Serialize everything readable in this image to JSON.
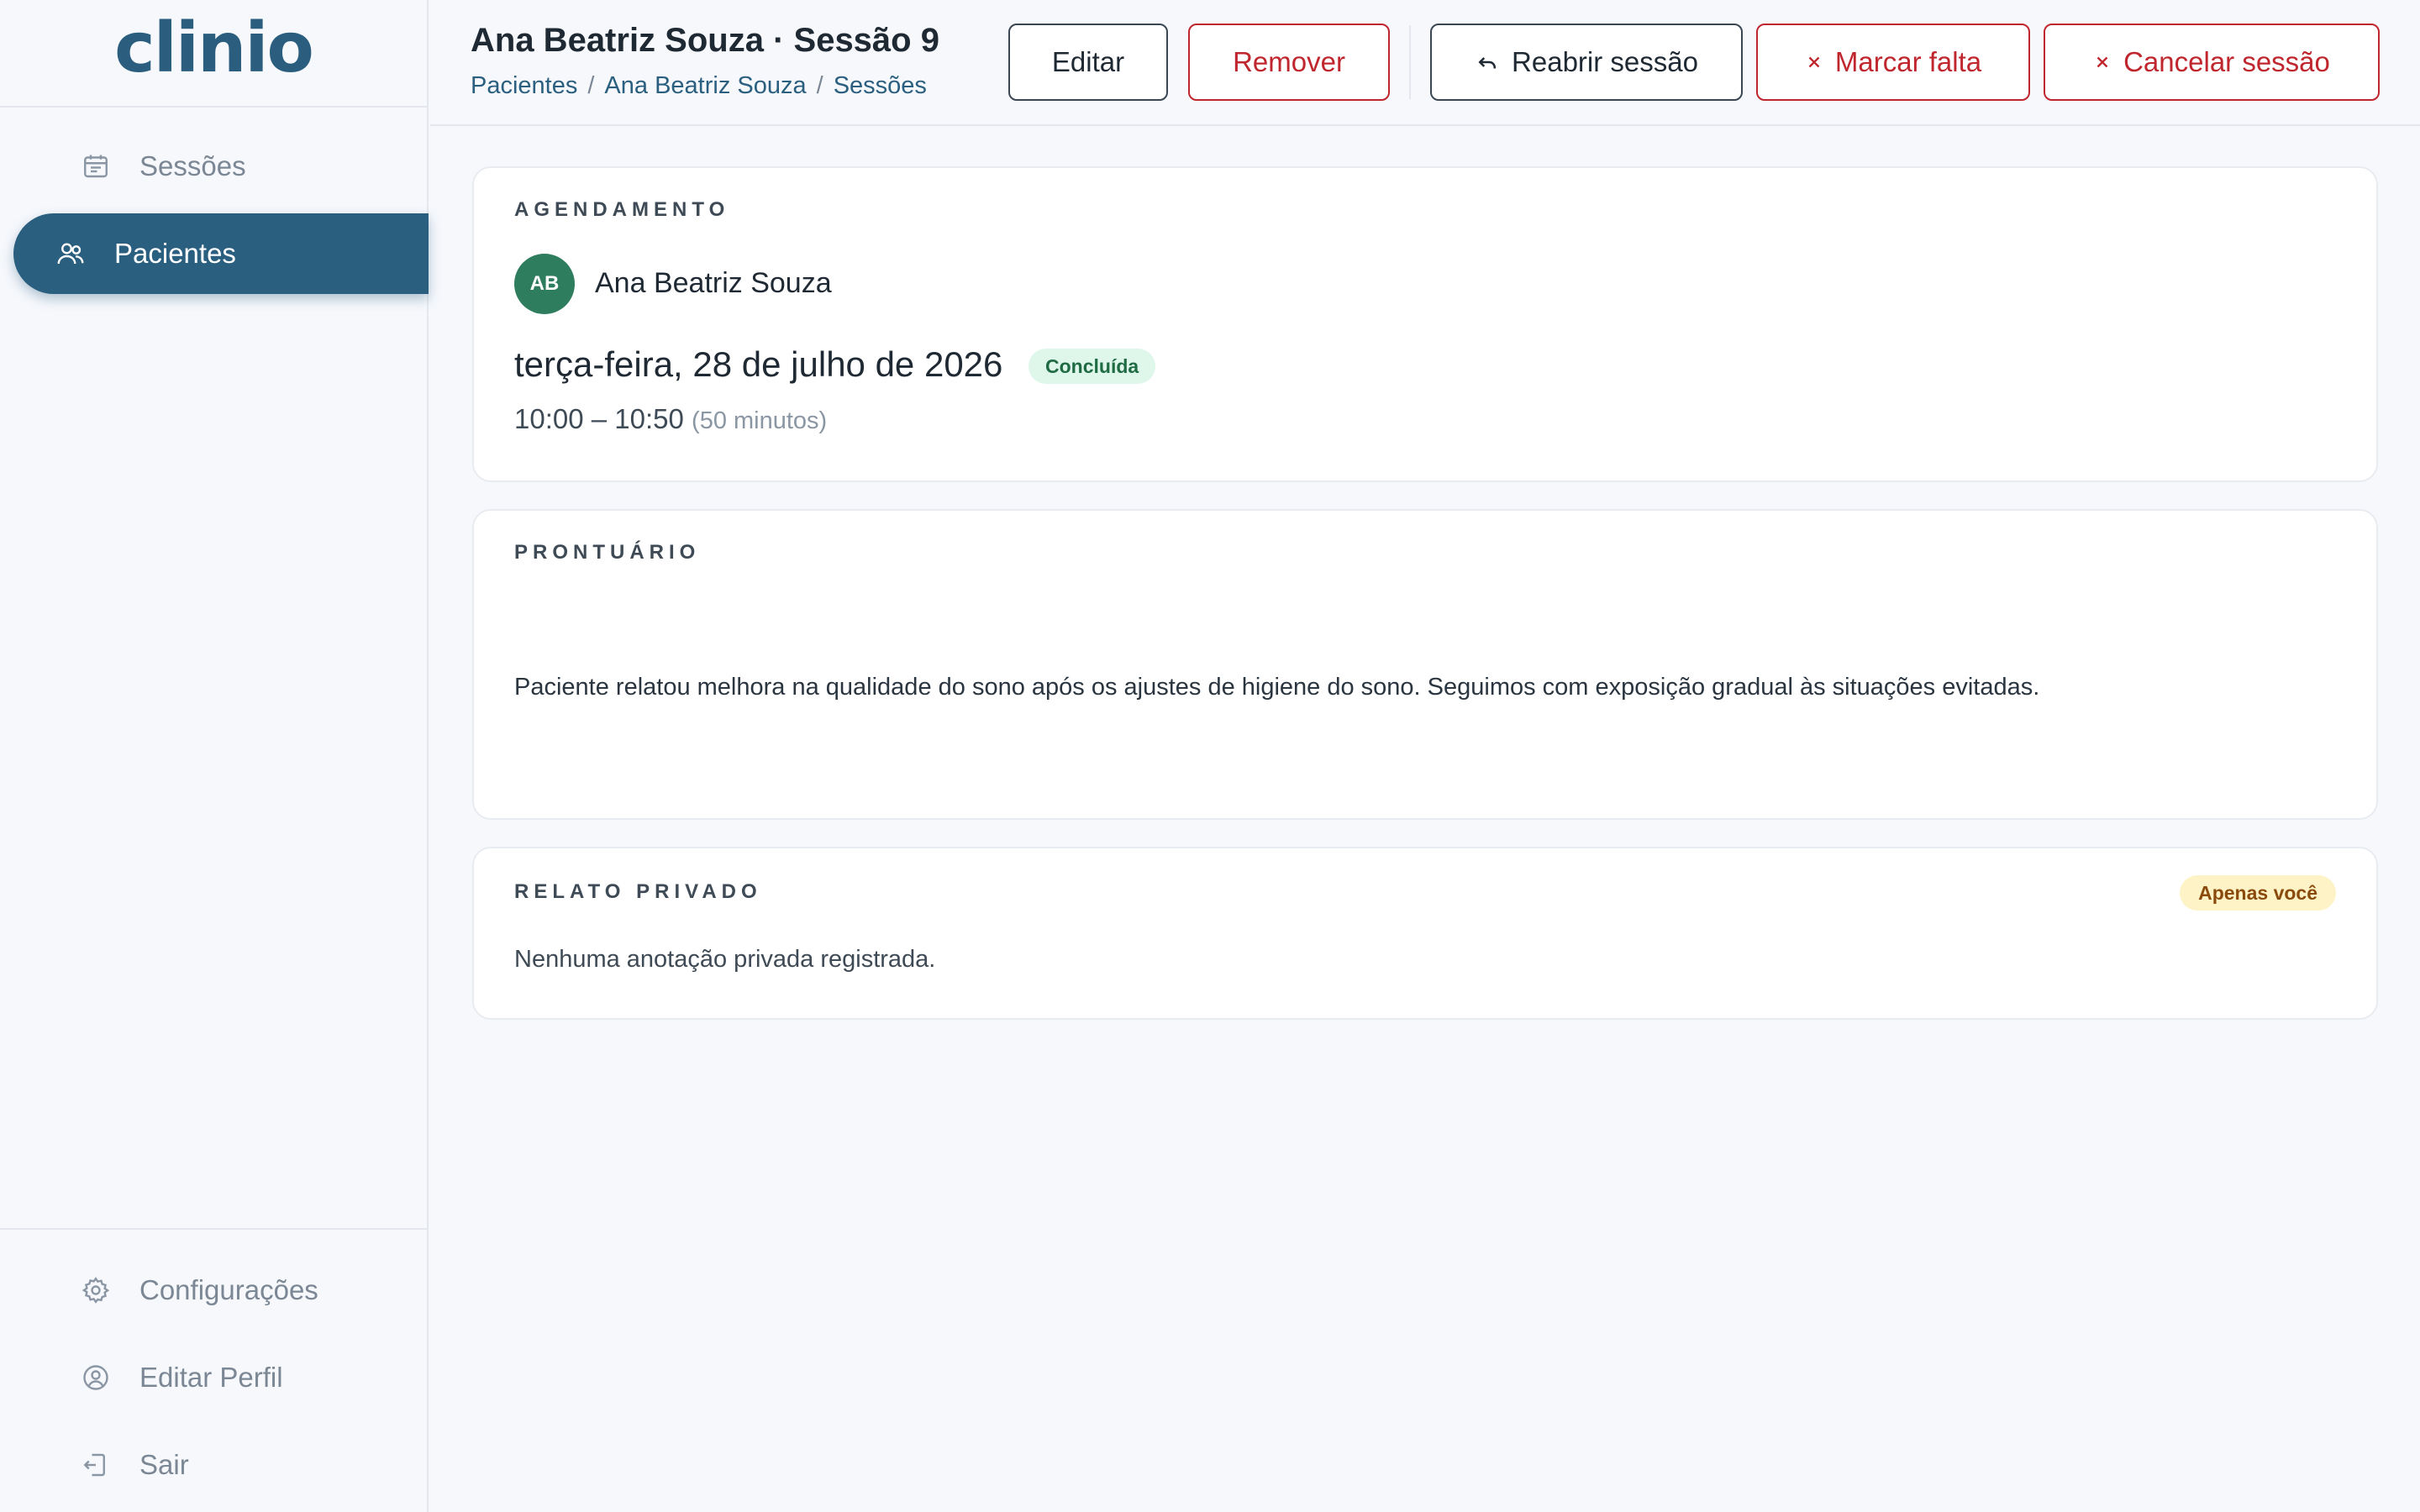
{
  "app": {
    "logo_text": "clinio"
  },
  "sidebar": {
    "items": [
      {
        "label": "Sessões",
        "icon": "calendar-icon",
        "active": false
      },
      {
        "label": "Pacientes",
        "icon": "users-icon",
        "active": true
      }
    ],
    "bottom_items": [
      {
        "label": "Configurações",
        "icon": "gear-icon"
      },
      {
        "label": "Editar Perfil",
        "icon": "user-circle-icon"
      },
      {
        "label": "Sair",
        "icon": "logout-icon"
      }
    ]
  },
  "header": {
    "title": "Ana Beatriz Souza · Sessão 9",
    "breadcrumb": [
      "Pacientes",
      "Ana Beatriz Souza",
      "Sessões"
    ],
    "breadcrumb_separator": "/",
    "buttons": {
      "edit": "Editar",
      "remove": "Remover",
      "reopen": "Reabrir sessão",
      "mark_absence": "Marcar falta",
      "cancel": "Cancelar sessão"
    }
  },
  "schedule": {
    "section_title": "AGENDAMENTO",
    "avatar_initials": "AB",
    "patient_name": "Ana Beatriz Souza",
    "date": "terça-feira, 28 de julho de 2026",
    "status": "Concluída",
    "time_range": "10:00 – 10:50",
    "duration": "(50 minutos)"
  },
  "record": {
    "section_title": "PRONTUÁRIO",
    "text": "Paciente relatou melhora na qualidade do sono após os ajustes de higiene do sono. Seguimos com exposição gradual às situações evitadas."
  },
  "private_note": {
    "section_title": "RELATO PRIVADO",
    "badge": "Apenas você",
    "empty_text": "Nenhuma anotação privada registrada."
  },
  "colors": {
    "brand": "#2b5f80",
    "danger": "#c0262d",
    "success_bg": "#def7ea",
    "warning_bg": "#fef3c7"
  }
}
